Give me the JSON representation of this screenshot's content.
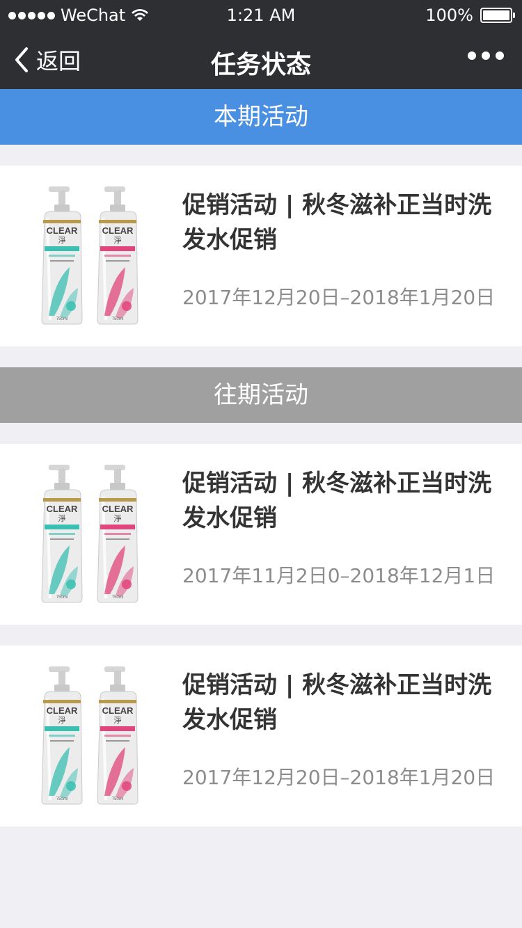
{
  "status_bar": {
    "carrier": "WeChat",
    "time": "1:21 AM",
    "battery": "100%"
  },
  "nav": {
    "back_label": "返回",
    "title": "任务状态"
  },
  "sections": {
    "current_label": "本期活动",
    "past_label": "往期活动"
  },
  "current_items": [
    {
      "title": "促销活动 | 秋冬滋补正当时洗发水促销",
      "date": "2017年12月20日–2018年1月20日"
    }
  ],
  "past_items": [
    {
      "title": "促销活动 | 秋冬滋补正当时洗发水促销",
      "date": "2017年11月2日0–2018年12月1日"
    },
    {
      "title": "促销活动 | 秋冬滋补正当时洗发水促销",
      "date": "2017年12月20日–2018年1月20日"
    }
  ],
  "product": {
    "brand": "CLEAR",
    "brand_cn": "淨",
    "volume": "750ml",
    "accent_left": "#3bbfb2",
    "accent_right": "#e0457b"
  }
}
